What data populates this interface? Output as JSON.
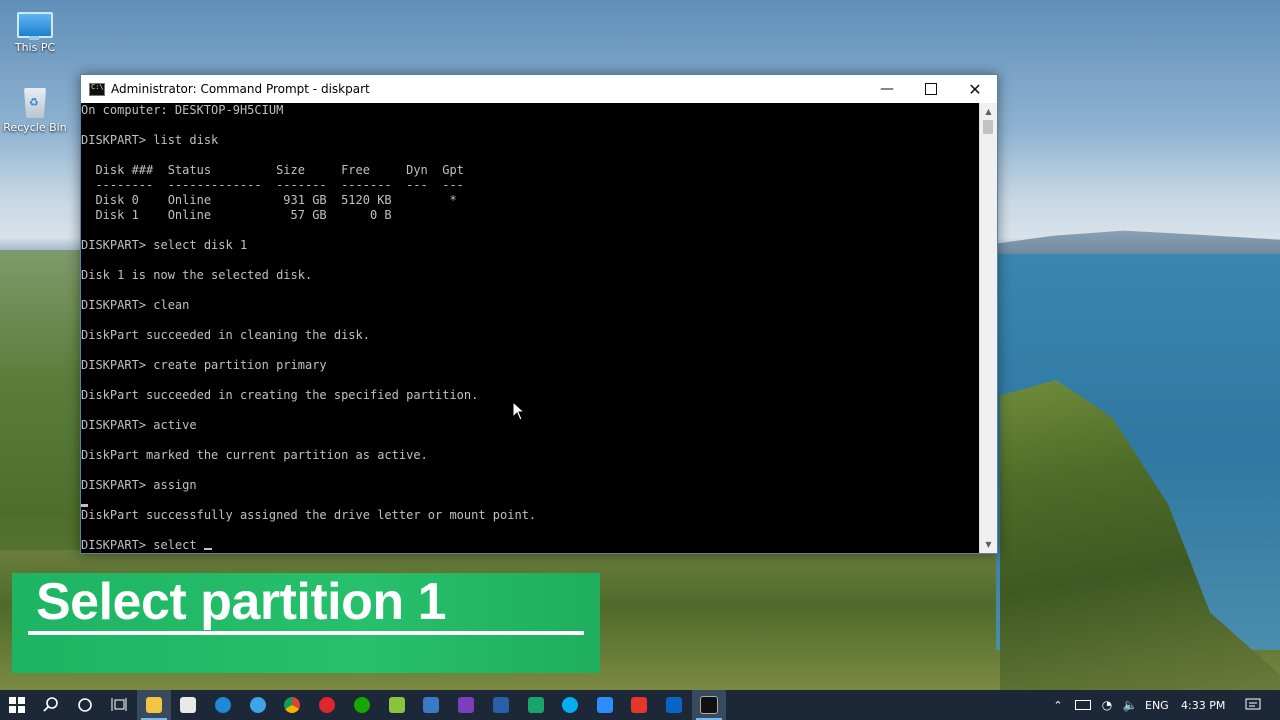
{
  "desktop": {
    "icons": [
      {
        "label": "This PC"
      },
      {
        "label": "Recycle Bin"
      }
    ]
  },
  "window": {
    "title": "Administrator: Command Prompt - diskpart",
    "buttons": {
      "minimize": "—",
      "close": "✕"
    }
  },
  "console": {
    "lines": [
      "On computer: DESKTOP-9H5CIUM",
      "",
      "DISKPART> list disk",
      "",
      "  Disk ###  Status         Size     Free     Dyn  Gpt",
      "  --------  -------------  -------  -------  ---  ---",
      "  Disk 0    Online          931 GB  5120 KB        *",
      "  Disk 1    Online           57 GB      0 B",
      "",
      "DISKPART> select disk 1",
      "",
      "Disk 1 is now the selected disk.",
      "",
      "DISKPART> clean",
      "",
      "DiskPart succeeded in cleaning the disk.",
      "",
      "DISKPART> create partition primary",
      "",
      "DiskPart succeeded in creating the specified partition.",
      "",
      "DISKPART> active",
      "",
      "DiskPart marked the current partition as active.",
      "",
      "DISKPART> assign",
      "",
      "DiskPart successfully assigned the drive letter or mount point.",
      "",
      "DISKPART> select "
    ]
  },
  "caption": {
    "text": "Select partition 1"
  },
  "taskbar": {
    "start_icon": "windows-logo-icon",
    "apps": [
      "search-icon",
      "cortana-icon",
      "task-view-icon",
      "file-explorer-icon",
      "store-icon",
      "edge-icon",
      "internet-explorer-icon",
      "chrome-icon",
      "opera-icon",
      "upwork-icon",
      "notepad-plus-icon",
      "app-icon",
      "visual-studio-icon",
      "powershell-icon",
      "defender-icon",
      "skype-icon",
      "zoom-icon",
      "pdf-icon",
      "outlook-icon",
      "command-prompt-icon"
    ],
    "tray": {
      "language": "ENG",
      "time": "4:33 PM"
    }
  },
  "colors": {
    "console_bg": "#000000",
    "console_text": "#c0c0c0",
    "caption_bg": "#22b866",
    "taskbar_bg": "#1c2838"
  }
}
